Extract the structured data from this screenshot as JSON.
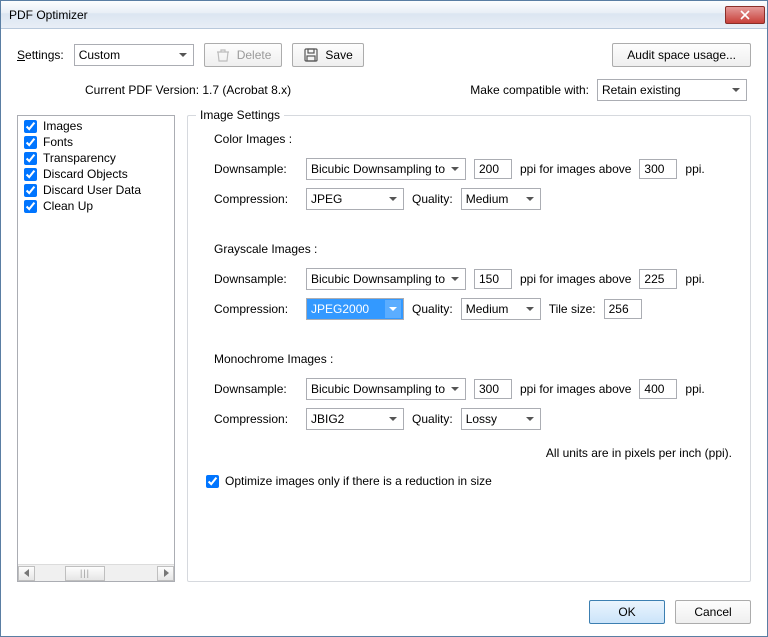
{
  "window": {
    "title": "PDF Optimizer"
  },
  "toolbar": {
    "settings_label": "Settings:",
    "settings_value": "Custom",
    "delete_label": "Delete",
    "save_label": "Save",
    "audit_label": "Audit space usage..."
  },
  "info": {
    "current_version_text": "Current PDF Version: 1.7 (Acrobat 8.x)",
    "compat_label": "Make compatible with:",
    "compat_value": "Retain existing"
  },
  "sidebar": {
    "items": [
      {
        "label": "Images",
        "checked": true
      },
      {
        "label": "Fonts",
        "checked": true
      },
      {
        "label": "Transparency",
        "checked": true
      },
      {
        "label": "Discard Objects",
        "checked": true
      },
      {
        "label": "Discard User Data",
        "checked": true
      },
      {
        "label": "Clean Up",
        "checked": true
      }
    ]
  },
  "group": {
    "title": "Image Settings",
    "color": {
      "heading": "Color Images :",
      "downsample_label": "Downsample:",
      "downsample_method": "Bicubic Downsampling to",
      "ppi": "200",
      "above_label": "ppi for images above",
      "ppi_above": "300",
      "ppi_unit": "ppi.",
      "compression_label": "Compression:",
      "compression_value": "JPEG",
      "quality_label": "Quality:",
      "quality_value": "Medium"
    },
    "gray": {
      "heading": "Grayscale Images :",
      "downsample_label": "Downsample:",
      "downsample_method": "Bicubic Downsampling to",
      "ppi": "150",
      "above_label": "ppi for images above",
      "ppi_above": "225",
      "ppi_unit": "ppi.",
      "compression_label": "Compression:",
      "compression_value": "JPEG2000",
      "quality_label": "Quality:",
      "quality_value": "Medium",
      "tilesize_label": "Tile size:",
      "tilesize_value": "256"
    },
    "mono": {
      "heading": "Monochrome Images :",
      "downsample_label": "Downsample:",
      "downsample_method": "Bicubic Downsampling to",
      "ppi": "300",
      "above_label": "ppi for images above",
      "ppi_above": "400",
      "ppi_unit": "ppi.",
      "compression_label": "Compression:",
      "compression_value": "JBIG2",
      "quality_label": "Quality:",
      "quality_value": "Lossy"
    },
    "units_note": "All units are in pixels per inch (ppi).",
    "optimize_only_label": "Optimize images only if there is a reduction in size",
    "optimize_only_checked": true
  },
  "footer": {
    "ok_label": "OK",
    "cancel_label": "Cancel"
  }
}
